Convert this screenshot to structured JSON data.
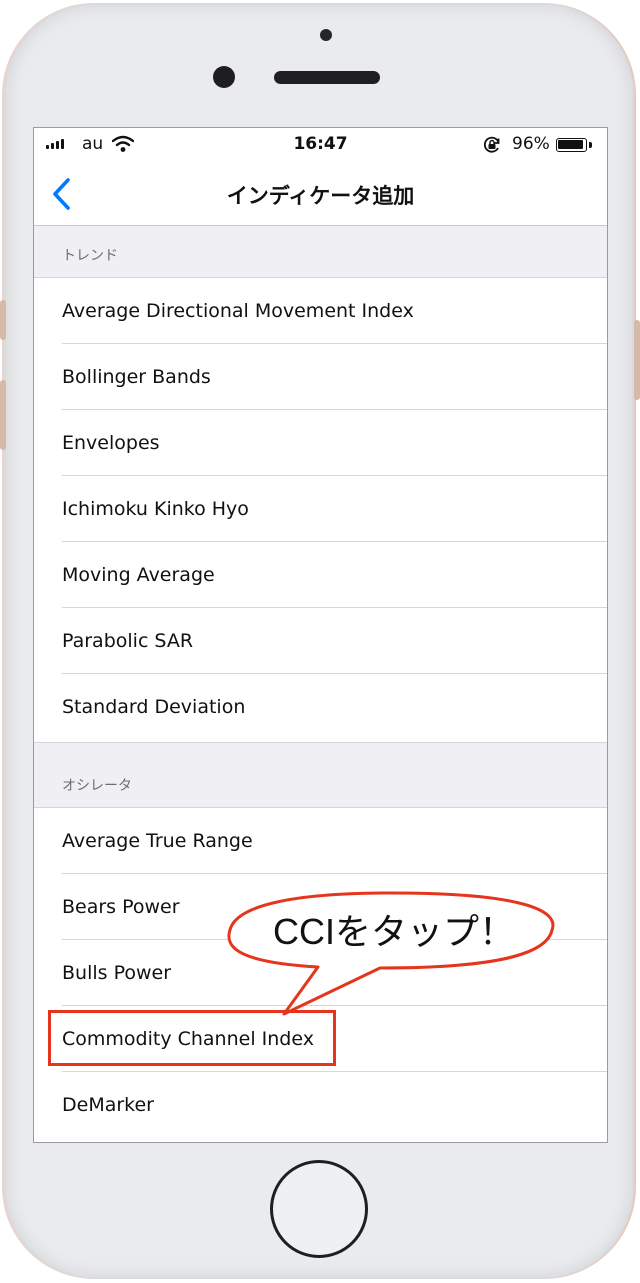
{
  "status_bar": {
    "carrier": "au",
    "time": "16:47",
    "battery_percent": "96%",
    "battery_level": 0.96
  },
  "nav": {
    "title": "インディケータ追加",
    "back_icon": "chevron-left-icon"
  },
  "sections": [
    {
      "header": "トレンド",
      "items": [
        {
          "label": "Average Directional Movement Index"
        },
        {
          "label": "Bollinger Bands"
        },
        {
          "label": "Envelopes"
        },
        {
          "label": "Ichimoku Kinko Hyo"
        },
        {
          "label": "Moving Average"
        },
        {
          "label": "Parabolic SAR"
        },
        {
          "label": "Standard Deviation"
        }
      ]
    },
    {
      "header": "オシレータ",
      "items": [
        {
          "label": "Average True Range"
        },
        {
          "label": "Bears Power"
        },
        {
          "label": "Bulls Power"
        },
        {
          "label": "Commodity Channel Index"
        },
        {
          "label": "DeMarker"
        }
      ]
    }
  ],
  "annotation": {
    "callout_text": "CCIをタップ！",
    "highlight_color": "#e5351d"
  },
  "colors": {
    "accent": "#007aff",
    "annotation_red": "#e5351d"
  }
}
